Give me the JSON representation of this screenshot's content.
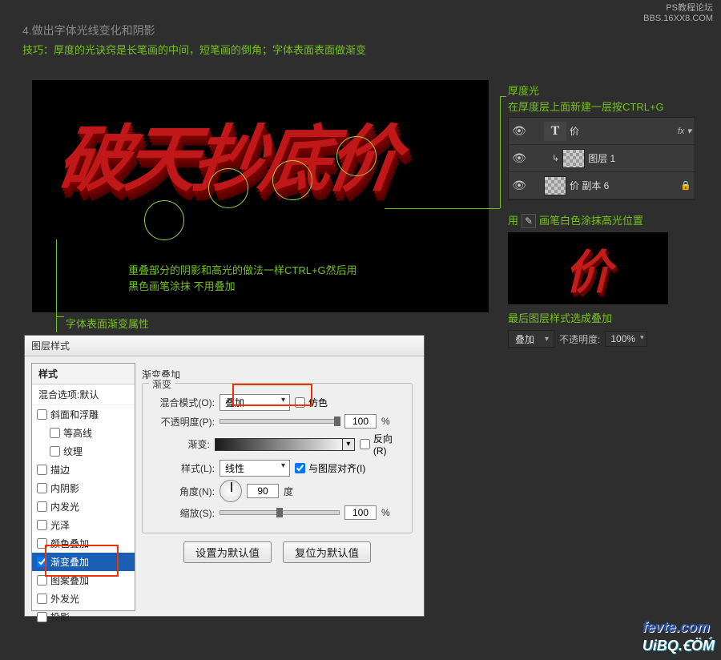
{
  "watermark_top": {
    "line1": "PS教程论坛",
    "line2": "BBS.16XX8.COM"
  },
  "step_title": "4.做出字体光线变化和阴影",
  "tip_line": "技巧：厚度的光诀窍是长笔画的中间，短笔画的倒角；字体表面表面做渐变",
  "big_text": "破天抄底价",
  "anno": {
    "overlap_l1": "重叠部分的阴影和高光的做法一样CTRL+G然后用",
    "overlap_l2": "黑色画笔涂抹 不用叠加",
    "gradprop": "字体表面渐变属性",
    "thick": "厚度光",
    "newlayer": "在厚度层上面新建一层按CTRL+G",
    "brush_prefix": "用",
    "brush_text": "画笔白色涂抹高光位置",
    "finalstyle": "最后图层样式选成叠加"
  },
  "layers": {
    "row1_name": "价",
    "row2_name": "图层 1",
    "row3_name": "价 副本 6",
    "fx_label": "fx ▾"
  },
  "preview_text": "价",
  "blendbar": {
    "mode": "叠加",
    "opacity_label": "不透明度:",
    "opacity_val": "100%"
  },
  "dlg": {
    "title": "图层样式",
    "left_head": "样式",
    "blend_defaults": "混合选项:默认",
    "items": {
      "bevel": "斜面和浮雕",
      "contour": "等高线",
      "texture": "纹理",
      "stroke": "描边",
      "innershadow": "内阴影",
      "innerglow": "内发光",
      "satin": "光泽",
      "coloroverlay": "颜色叠加",
      "gradoverlay": "渐变叠加",
      "patternoverlay": "图案叠加",
      "outerglow": "外发光",
      "dropshadow": "投影"
    },
    "group_title": "渐变叠加",
    "legend": "渐变",
    "blendmode_label": "混合模式(O):",
    "blendmode_value": "叠加",
    "dither_label": "仿色",
    "opacity_label": "不透明度(P):",
    "opacity_value": "100",
    "pct": "%",
    "gradient_label": "渐变:",
    "reverse_label": "反向(R)",
    "style_label": "样式(L):",
    "style_value": "线性",
    "align_label": "与图层对齐(I)",
    "angle_label": "角度(N):",
    "angle_value": "90",
    "angle_unit": "度",
    "scale_label": "缩放(S):",
    "scale_value": "100",
    "btn_default": "设置为默认值",
    "btn_reset": "复位为默认值"
  },
  "watermark_bottom": {
    "l1": "fevte.com",
    "l2": "UiBQ.ꞒÖḾ"
  }
}
